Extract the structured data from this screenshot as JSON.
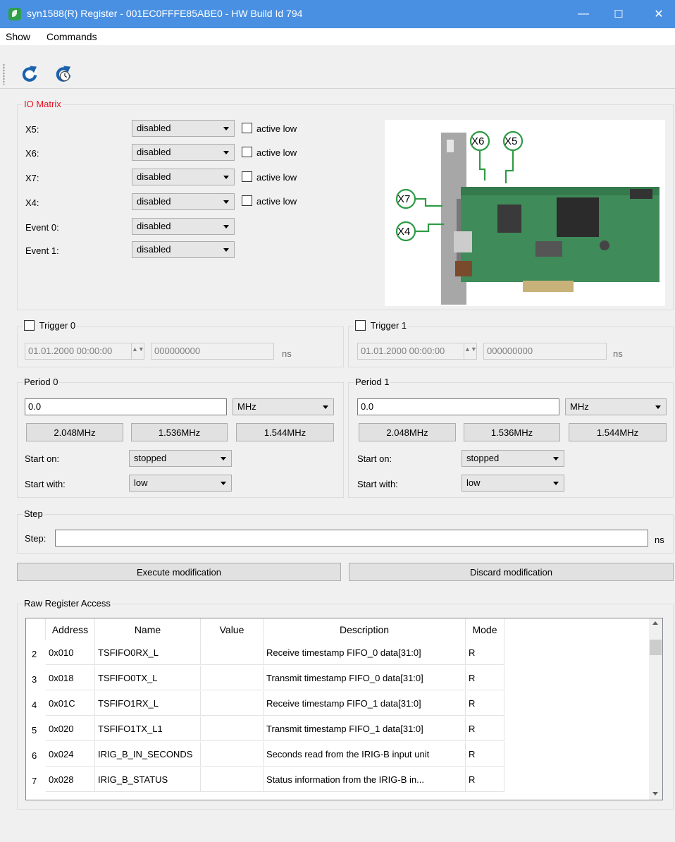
{
  "window": {
    "title": "syn1588(R) Register - 001EC0FFFE85ABE0 - HW Build Id 794",
    "minimize": "—",
    "maximize": "☐",
    "close": "✕"
  },
  "menu": {
    "show": "Show",
    "commands": "Commands"
  },
  "toolbar": {
    "refresh_icon": "refresh-icon",
    "auto_refresh_icon": "auto-refresh-icon"
  },
  "io_matrix": {
    "title": "IO Matrix",
    "title_color": "#e81123",
    "rows": [
      {
        "label": "X5:",
        "value": "disabled",
        "active_low": "active low"
      },
      {
        "label": "X6:",
        "value": "disabled",
        "active_low": "active low"
      },
      {
        "label": "X7:",
        "value": "disabled",
        "active_low": "active low"
      },
      {
        "label": "X4:",
        "value": "disabled",
        "active_low": "active low"
      },
      {
        "label": "Event 0:",
        "value": "disabled"
      },
      {
        "label": "Event 1:",
        "value": "disabled"
      }
    ],
    "image_callouts": [
      "X6",
      "X5",
      "X7",
      "X4"
    ]
  },
  "trigger0": {
    "title": "Trigger 0",
    "datetime": "01.01.2000 00:00:00",
    "ns_value": "000000000",
    "unit": "ns"
  },
  "trigger1": {
    "title": "Trigger 1",
    "datetime": "01.01.2000 00:00:00",
    "ns_value": "000000000",
    "unit": "ns"
  },
  "period0": {
    "title": "Period 0",
    "value": "0.0",
    "unit": "MHz",
    "presets": [
      "2.048MHz",
      "1.536MHz",
      "1.544MHz"
    ],
    "start_on_label": "Start on:",
    "start_on": "stopped",
    "start_with_label": "Start with:",
    "start_with": "low"
  },
  "period1": {
    "title": "Period 1",
    "value": "0.0",
    "unit": "MHz",
    "presets": [
      "2.048MHz",
      "1.536MHz",
      "1.544MHz"
    ],
    "start_on_label": "Start on:",
    "start_on": "stopped",
    "start_with_label": "Start with:",
    "start_with": "low"
  },
  "step": {
    "title": "Step",
    "label": "Step:",
    "value": "",
    "unit": "ns"
  },
  "actions": {
    "execute": "Execute modification",
    "discard": "Discard modification"
  },
  "raw": {
    "title": "Raw Register Access",
    "columns": [
      "Address",
      "Name",
      "Value",
      "Description",
      "Mode"
    ],
    "rows": [
      {
        "num": "2",
        "address": "0x010",
        "name": "TSFIFO0RX_L",
        "value": "",
        "description": "Receive timestamp FIFO_0 data[31:0]",
        "mode": "R"
      },
      {
        "num": "3",
        "address": "0x018",
        "name": "TSFIFO0TX_L",
        "value": "",
        "description": "Transmit timestamp FIFO_0 data[31:0]",
        "mode": "R"
      },
      {
        "num": "4",
        "address": "0x01C",
        "name": "TSFIFO1RX_L",
        "value": "",
        "description": "Receive timestamp FIFO_1 data[31:0]",
        "mode": "R"
      },
      {
        "num": "5",
        "address": "0x020",
        "name": "TSFIFO1TX_L1",
        "value": "",
        "description": "Transmit timestamp FIFO_1 data[31:0]",
        "mode": "R"
      },
      {
        "num": "6",
        "address": "0x024",
        "name": "IRIG_B_IN_SECONDS",
        "value": "",
        "description": "Seconds read from the IRIG-B input unit",
        "mode": "R"
      },
      {
        "num": "7",
        "address": "0x028",
        "name": "IRIG_B_STATUS",
        "value": "",
        "description": "Status information from the IRIG-B in...",
        "mode": "R"
      }
    ]
  }
}
